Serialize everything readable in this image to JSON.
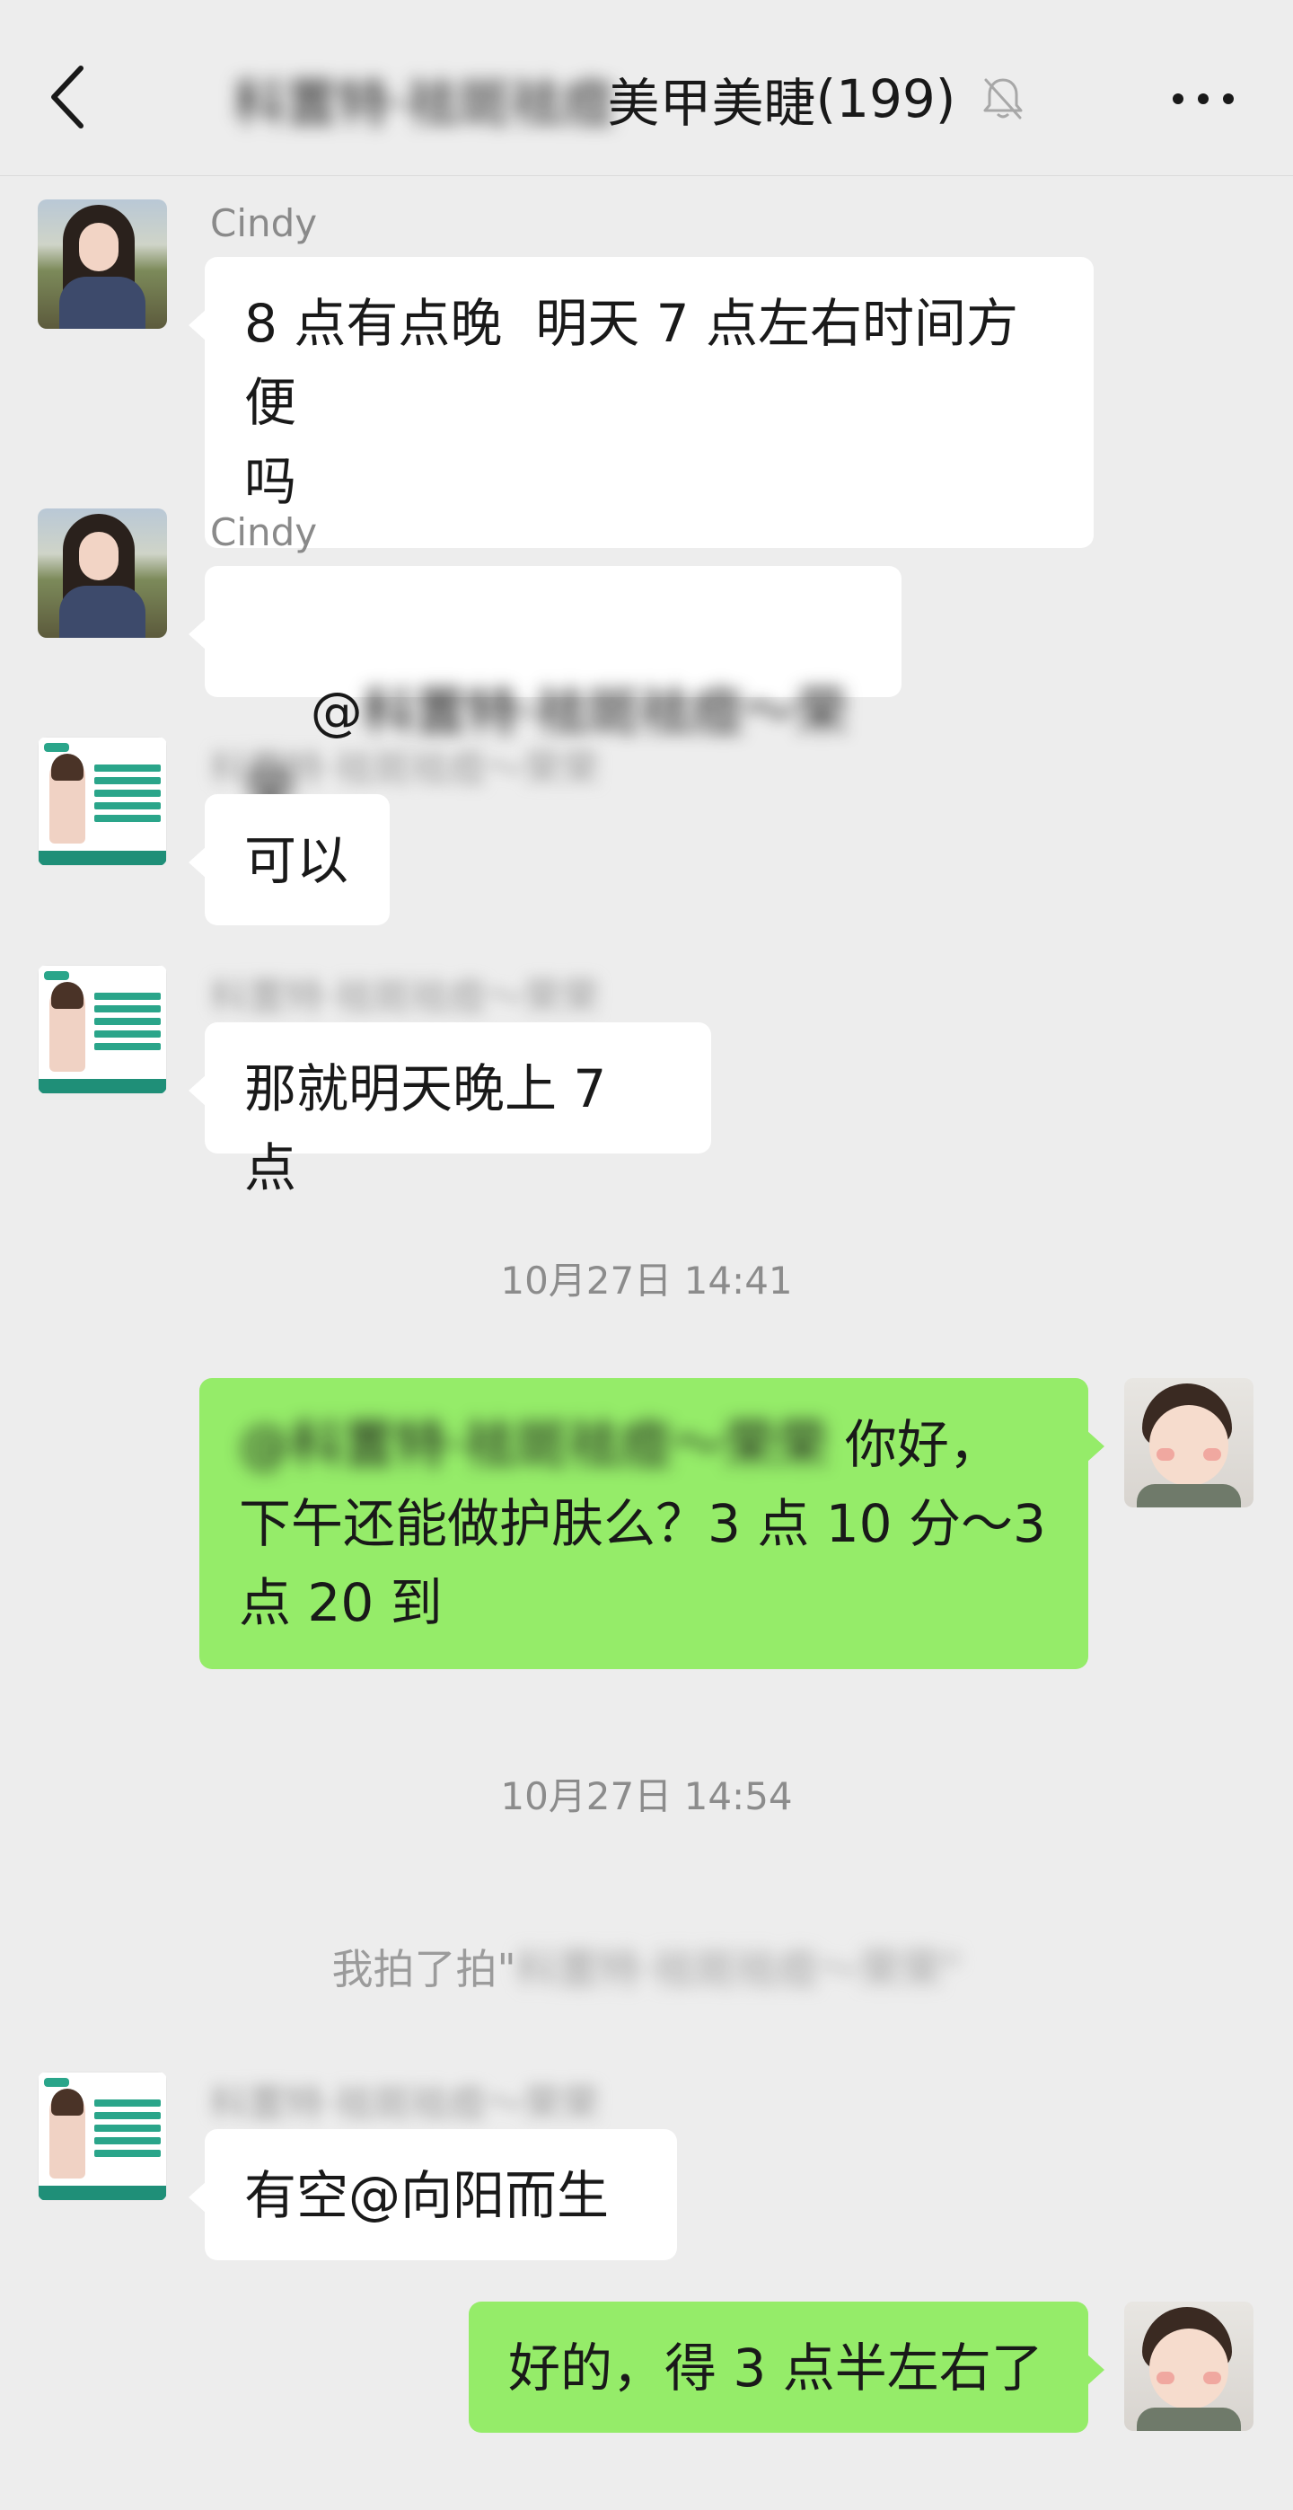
{
  "header": {
    "title_blurred": "科置特·祛斑祛痘",
    "title_visible": "美甲美睫",
    "member_count": "(199)"
  },
  "messages": [
    {
      "sender": "Cindy",
      "text": "8 点有点晚  明天 7 点左右时间方便\n吗"
    },
    {
      "sender": "Cindy",
      "text_prefix": "@",
      "text_blurred": "科置特·祛斑祛痘～荣荣"
    },
    {
      "sender_blurred": "科置特·祛斑祛痘～荣荣",
      "text": "可以"
    },
    {
      "sender_blurred": "科置特·祛斑祛痘～荣荣",
      "text": "那就明天晚上 7 点"
    },
    {
      "timestamp": "10月27日 14:41"
    },
    {
      "text_blurred": "@科置特·祛斑祛痘～荣荣",
      "text_line1_rest": " 你好，",
      "text_rest": "下午还能做护肤么？3 点 10 分～3\n点 20 到"
    },
    {
      "timestamp": "10月27日 14:54"
    },
    {
      "system_prefix": "我拍了拍\"",
      "system_blurred": "科置特·祛斑祛痘～荣荣\""
    },
    {
      "sender_blurred": "科置特·祛斑祛痘～荣荣",
      "text": "有空@向阳而生"
    },
    {
      "text": "好的，得 3 点半左右了"
    }
  ],
  "icons": {
    "back": "chevron-left-icon",
    "mute": "bell-off-icon",
    "more": "more-dots-icon"
  },
  "colors": {
    "background": "#ededed",
    "incoming_bubble": "#ffffff",
    "outgoing_bubble": "#95ec69"
  }
}
